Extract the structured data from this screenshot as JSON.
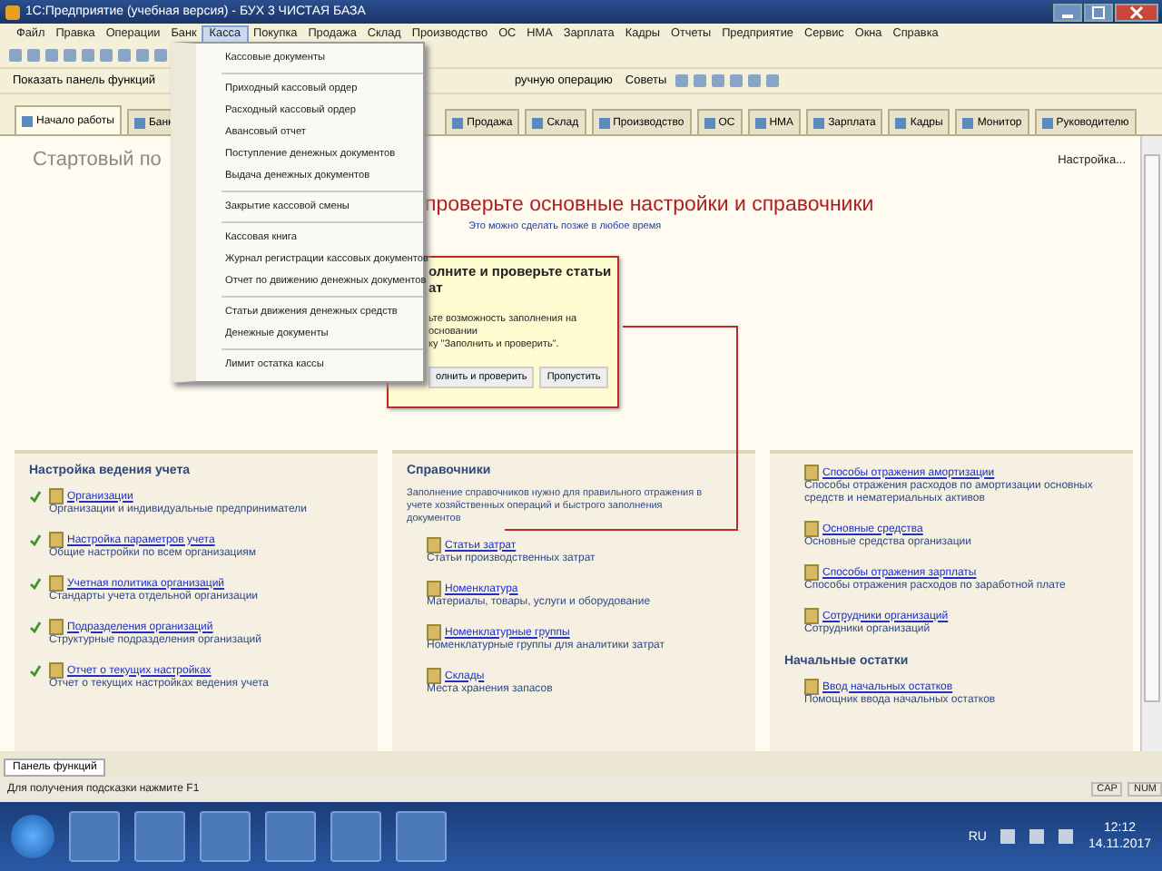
{
  "window": {
    "title": "1С:Предприятие (учебная версия) - БУХ 3 ЧИСТАЯ БАЗА"
  },
  "menu_bar": [
    {
      "label": "Файл",
      "selected": false
    },
    {
      "label": "Правка",
      "selected": false
    },
    {
      "label": "Операции",
      "selected": false
    },
    {
      "label": "Банк",
      "selected": false
    },
    {
      "label": "Касса",
      "selected": true
    },
    {
      "label": "Покупка",
      "selected": false
    },
    {
      "label": "Продажа",
      "selected": false
    },
    {
      "label": "Склад",
      "selected": false
    },
    {
      "label": "Производство",
      "selected": false
    },
    {
      "label": "ОС",
      "selected": false
    },
    {
      "label": "НМА",
      "selected": false
    },
    {
      "label": "Зарплата",
      "selected": false
    },
    {
      "label": "Кадры",
      "selected": false
    },
    {
      "label": "Отчеты",
      "selected": false
    },
    {
      "label": "Предприятие",
      "selected": false
    },
    {
      "label": "Сервис",
      "selected": false
    },
    {
      "label": "Окна",
      "selected": false
    },
    {
      "label": "Справка",
      "selected": false
    }
  ],
  "toolbar": {
    "show_panel": "Показать панель функций",
    "operation": "ручную операцию",
    "tips": "Советы"
  },
  "open_menu": {
    "groups": [
      [
        "Кассовые документы"
      ],
      [
        "Приходный кассовый ордер",
        "Расходный кассовый ордер",
        "Авансовый отчет",
        "Поступление денежных документов",
        "Выдача денежных документов"
      ],
      [
        "Закрытие кассовой смены"
      ],
      [
        "Кассовая книга",
        "Журнал регистрации кассовых документов",
        "Отчет по движению денежных документов"
      ],
      [
        "Статьи движения денежных средств",
        "Денежные документы"
      ],
      [
        "Лимит остатка кассы"
      ]
    ]
  },
  "tabs": [
    {
      "label": "Начало работы",
      "selected": true
    },
    {
      "label": "Банк",
      "selected": false
    },
    {
      "label": "Продажа",
      "selected": false
    },
    {
      "label": "Склад",
      "selected": false
    },
    {
      "label": "Производство",
      "selected": false
    },
    {
      "label": "ОС",
      "selected": false
    },
    {
      "label": "НМА",
      "selected": false
    },
    {
      "label": "Зарплата",
      "selected": false
    },
    {
      "label": "Кадры",
      "selected": false
    },
    {
      "label": "Монитор",
      "selected": false
    },
    {
      "label": "Руководителю",
      "selected": false
    }
  ],
  "page": {
    "title": "Стартовый по",
    "settings_link": "Настройка...",
    "headline": "проверьте основные настройки и справочники",
    "subtitle": "Это можно сделать позже в любое время"
  },
  "hint": {
    "title_lines": [
      "олните и проверьте статьи",
      "ат"
    ],
    "text_lines": [
      "ьте возможность заполнения на основании",
      "ку \"Заполнить и проверить\"."
    ],
    "primary_button": "олнить и проверить",
    "skip_button": "Пропустить"
  },
  "panels": [
    {
      "title": "Настройка ведения учета",
      "items": [
        {
          "link": "Организации",
          "text": "Организации и индивидуальные предприниматели",
          "done": true
        },
        {
          "link": "Настройка параметров учета",
          "text": "Общие настройки по всем организациям",
          "done": true
        },
        {
          "link": "Учетная политика организаций",
          "text": "Стандарты учета отдельной организации",
          "done": true
        },
        {
          "link": "Подразделения организаций",
          "text": "Структурные подразделения организаций",
          "done": true
        },
        {
          "link": "Отчет о текущих настройках",
          "text": "Отчет о текущих настройках ведения учета",
          "done": true
        }
      ]
    },
    {
      "title": "Справочники",
      "description": "Заполнение справочников нужно для правильного отражения в учете хозяйственных операций и быстрого заполнения документов",
      "items": [
        {
          "link": "Статьи затрат",
          "text": "Статьи производственных затрат",
          "done": false
        },
        {
          "link": "Номенклатура",
          "text": "Материалы, товары, услуги и оборудование",
          "done": false
        },
        {
          "link": "Номенклатурные группы",
          "text": "Номенклатурные группы для аналитики затрат",
          "done": false
        },
        {
          "link": "Склады",
          "text": "Места хранения запасов",
          "done": false
        }
      ]
    },
    {
      "items": [
        {
          "link": "Способы отражения амортизации",
          "text": "Способы отражения расходов по амортизации основных средств и нематериальных активов",
          "done": false
        },
        {
          "link": "Основные средства",
          "text": "Основные средства организации",
          "done": false
        },
        {
          "link": "Способы отражения зарплаты",
          "text": "Способы отражения расходов по заработной плате",
          "done": false
        },
        {
          "link": "Сотрудники организаций",
          "text": "Сотрудники организаций",
          "done": false
        }
      ],
      "subsection": {
        "title": "Начальные остатки",
        "link": "Ввод начальных остатков",
        "text": "Помощник ввода начальных остатков"
      }
    }
  ],
  "function_panel_tab": "Панель функций",
  "status_bar": {
    "hint": "Для получения подсказки нажмите F1",
    "indicators": [
      "CAP",
      "NUM"
    ]
  },
  "taskbar": {
    "language": "RU",
    "time": "12:12",
    "date": "14.11.2017"
  }
}
